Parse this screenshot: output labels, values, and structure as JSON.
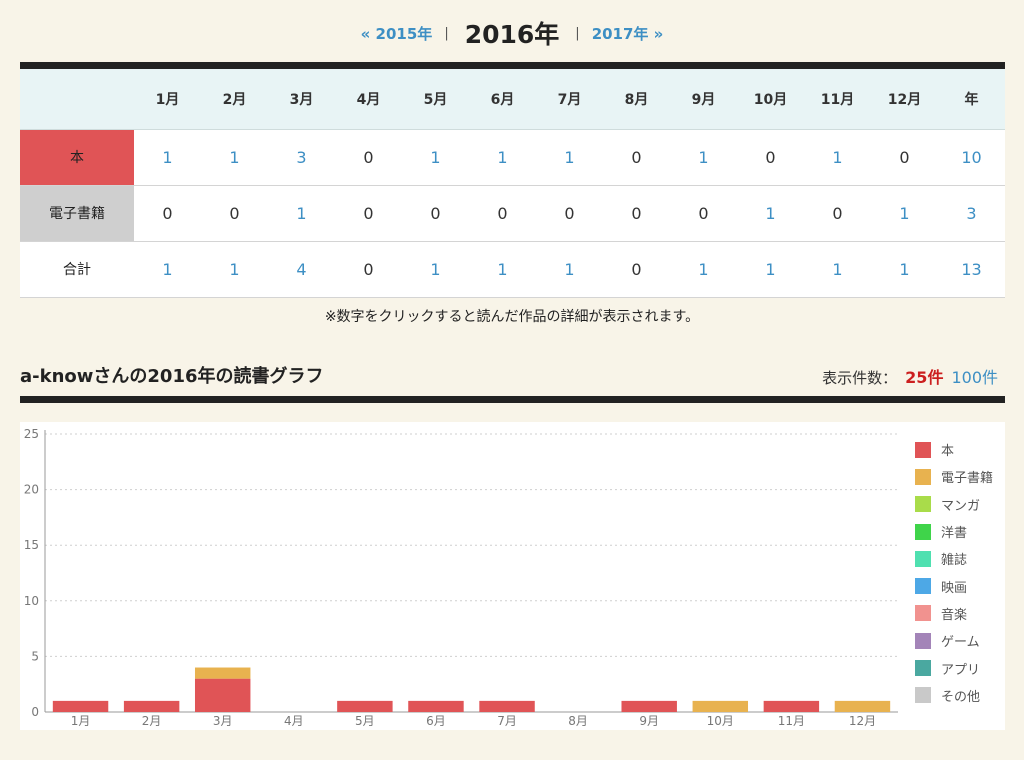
{
  "nav": {
    "prev_label": "« 2015年",
    "current_label": "2016年",
    "next_label": "2017年 »",
    "separator": "|"
  },
  "stats_table": {
    "months": [
      "1月",
      "2月",
      "3月",
      "4月",
      "5月",
      "6月",
      "7月",
      "8月",
      "9月",
      "10月",
      "11月",
      "12月",
      "年"
    ],
    "rows": [
      {
        "label": "本",
        "values": [
          1,
          1,
          3,
          0,
          1,
          1,
          1,
          0,
          1,
          0,
          1,
          0,
          10
        ]
      },
      {
        "label": "電子書籍",
        "values": [
          0,
          0,
          1,
          0,
          0,
          0,
          0,
          0,
          0,
          1,
          0,
          1,
          3
        ]
      },
      {
        "label": "合計",
        "values": [
          1,
          1,
          4,
          0,
          1,
          1,
          1,
          0,
          1,
          1,
          1,
          1,
          13
        ]
      }
    ]
  },
  "note": "※数字をクリックすると読んだ作品の詳細が表示されます。",
  "graph": {
    "title": "a-knowさんの2016年の読書グラフ",
    "count_label": "表示件数：",
    "count_active": "25件",
    "count_alt": "100件"
  },
  "chart_data": {
    "type": "bar",
    "stacked": true,
    "categories": [
      "1月",
      "2月",
      "3月",
      "4月",
      "5月",
      "6月",
      "7月",
      "8月",
      "9月",
      "10月",
      "11月",
      "12月"
    ],
    "ylim": [
      0,
      25
    ],
    "yticks": [
      0,
      5,
      10,
      15,
      20,
      25
    ],
    "grid": true,
    "legend_position": "right",
    "series": [
      {
        "name": "本",
        "color": "#e05456",
        "values": [
          1,
          1,
          3,
          0,
          1,
          1,
          1,
          0,
          1,
          0,
          1,
          0
        ]
      },
      {
        "name": "電子書籍",
        "color": "#e8b24f",
        "values": [
          0,
          0,
          1,
          0,
          0,
          0,
          0,
          0,
          0,
          1,
          0,
          1
        ]
      },
      {
        "name": "マンガ",
        "color": "#a9dc4a",
        "values": [
          0,
          0,
          0,
          0,
          0,
          0,
          0,
          0,
          0,
          0,
          0,
          0
        ]
      },
      {
        "name": "洋書",
        "color": "#3fd44a",
        "values": [
          0,
          0,
          0,
          0,
          0,
          0,
          0,
          0,
          0,
          0,
          0,
          0
        ]
      },
      {
        "name": "雑誌",
        "color": "#4fe0b0",
        "values": [
          0,
          0,
          0,
          0,
          0,
          0,
          0,
          0,
          0,
          0,
          0,
          0
        ]
      },
      {
        "name": "映画",
        "color": "#4da8e6",
        "values": [
          0,
          0,
          0,
          0,
          0,
          0,
          0,
          0,
          0,
          0,
          0,
          0
        ]
      },
      {
        "name": "音楽",
        "color": "#f1928f",
        "values": [
          0,
          0,
          0,
          0,
          0,
          0,
          0,
          0,
          0,
          0,
          0,
          0
        ]
      },
      {
        "name": "ゲーム",
        "color": "#a384b8",
        "values": [
          0,
          0,
          0,
          0,
          0,
          0,
          0,
          0,
          0,
          0,
          0,
          0
        ]
      },
      {
        "name": "アプリ",
        "color": "#4aa8a0",
        "values": [
          0,
          0,
          0,
          0,
          0,
          0,
          0,
          0,
          0,
          0,
          0,
          0
        ]
      },
      {
        "name": "その他",
        "color": "#c9c9c9",
        "values": [
          0,
          0,
          0,
          0,
          0,
          0,
          0,
          0,
          0,
          0,
          0,
          0
        ]
      }
    ]
  }
}
